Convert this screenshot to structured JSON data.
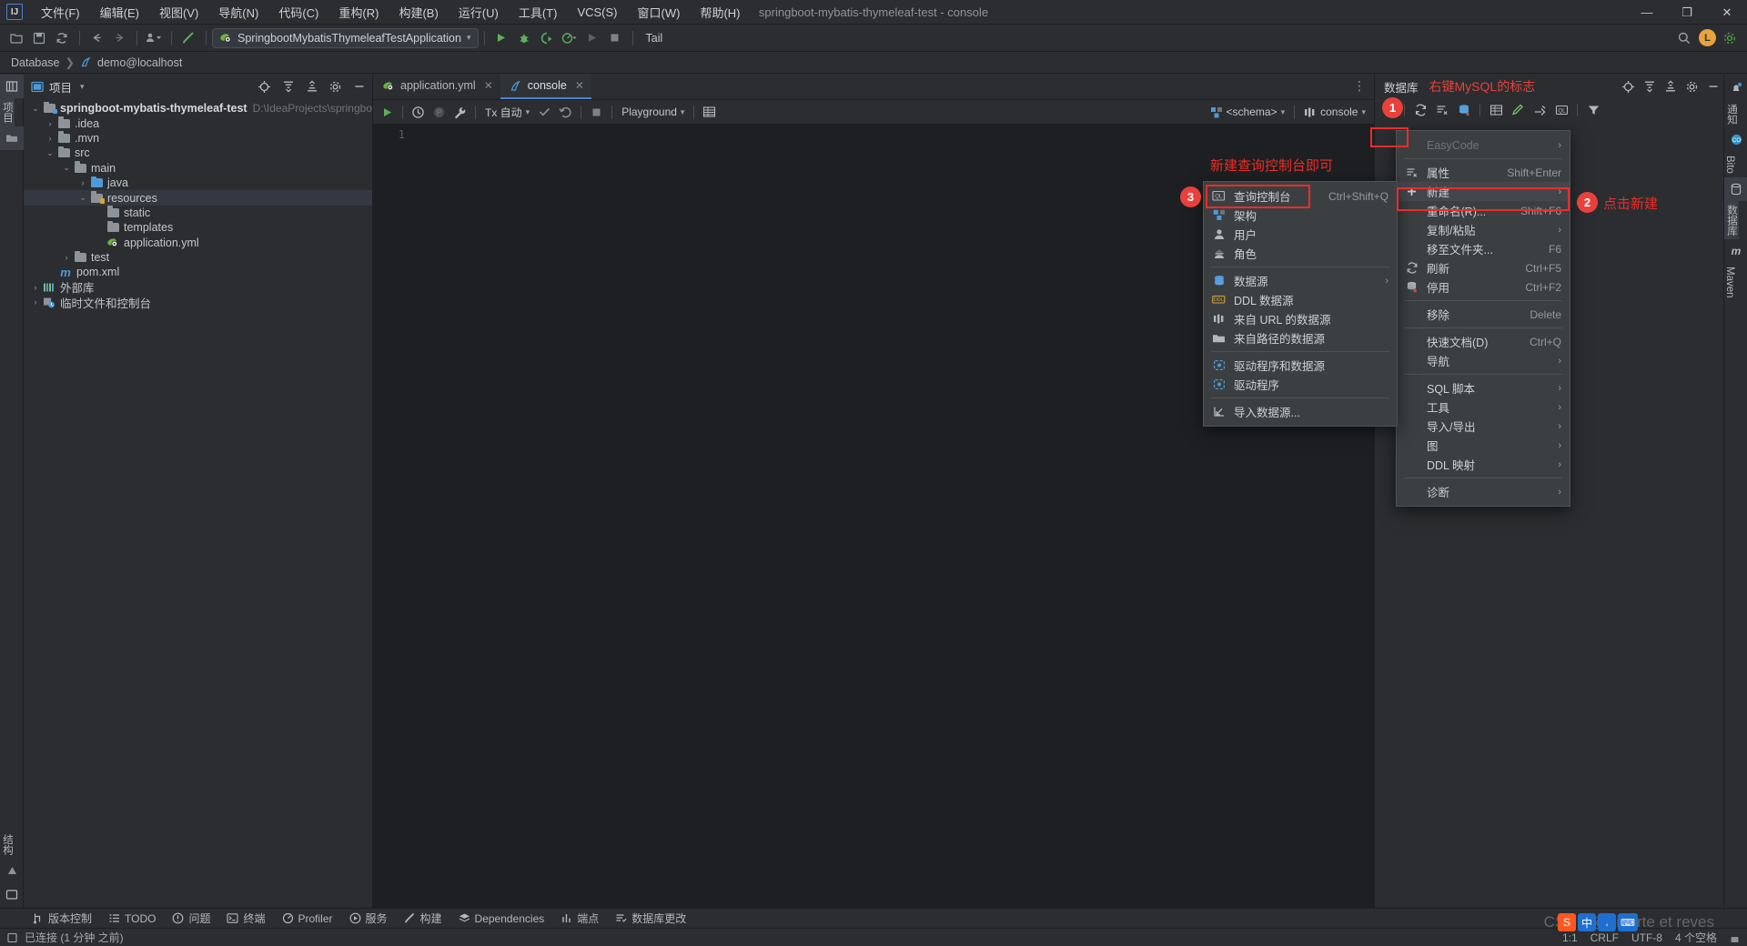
{
  "window": {
    "title": "springboot-mybatis-thymeleaf-test - console",
    "logo": "IJ",
    "controls": {
      "minimize": "—",
      "maximize": "❐",
      "close": "✕"
    }
  },
  "menubar": [
    {
      "label": "文件(F)"
    },
    {
      "label": "编辑(E)"
    },
    {
      "label": "视图(V)"
    },
    {
      "label": "导航(N)"
    },
    {
      "label": "代码(C)"
    },
    {
      "label": "重构(R)"
    },
    {
      "label": "构建(B)"
    },
    {
      "label": "运行(U)"
    },
    {
      "label": "工具(T)"
    },
    {
      "label": "VCS(S)"
    },
    {
      "label": "窗口(W)"
    },
    {
      "label": "帮助(H)"
    }
  ],
  "toolbar": {
    "icons": [
      "open-folder-icon",
      "save-icon",
      "sync-icon",
      "back-arrow-icon",
      "forward-arrow-icon",
      "profile-dropdown-icon",
      "build-hammer-icon"
    ],
    "run_config": "SpringbootMybatisThymeleafTestApplication",
    "run_label": "run-icon",
    "debug_label": "debug-icon",
    "coverage_label": "coverage-icon",
    "profile_label": "profile-icon",
    "stop_label": "stop-icon",
    "tail_chip": "Tail",
    "right_icons": [
      "search-icon",
      "avatar",
      "settings-icon"
    ],
    "avatar_initial": "L"
  },
  "breadcrumb": {
    "root": "Database",
    "sep": "❯",
    "current": "demo@localhost"
  },
  "project_panel": {
    "title": "项目",
    "header_icons": [
      "locate-icon",
      "expand-all-icon",
      "collapse-all-icon",
      "gear-icon",
      "hide-icon"
    ],
    "tree": [
      {
        "depth": 0,
        "chev": "⌄",
        "icon": "module-folder",
        "label": "springboot-mybatis-thymeleaf-test",
        "bold": true,
        "path": "D:\\IdeaProjects\\springboot-mybatis-",
        "selected": false
      },
      {
        "depth": 1,
        "chev": "›",
        "icon": "folder",
        "label": ".idea",
        "bold": false,
        "path": "",
        "selected": false
      },
      {
        "depth": 1,
        "chev": "›",
        "icon": "folder",
        "label": ".mvn",
        "bold": false,
        "path": "",
        "selected": false
      },
      {
        "depth": 1,
        "chev": "⌄",
        "icon": "folder",
        "label": "src",
        "bold": false,
        "path": "",
        "selected": false
      },
      {
        "depth": 2,
        "chev": "⌄",
        "icon": "folder",
        "label": "main",
        "bold": false,
        "path": "",
        "selected": false
      },
      {
        "depth": 3,
        "chev": "›",
        "icon": "folder-blue",
        "label": "java",
        "bold": false,
        "path": "",
        "selected": false
      },
      {
        "depth": 3,
        "chev": "⌄",
        "icon": "folder-res",
        "label": "resources",
        "bold": false,
        "path": "",
        "selected": true
      },
      {
        "depth": 4,
        "chev": "",
        "icon": "folder",
        "label": "static",
        "bold": false,
        "path": "",
        "selected": false
      },
      {
        "depth": 4,
        "chev": "",
        "icon": "folder",
        "label": "templates",
        "bold": false,
        "path": "",
        "selected": false
      },
      {
        "depth": 4,
        "chev": "",
        "icon": "spring-yml",
        "label": "application.yml",
        "bold": false,
        "path": "",
        "selected": false
      },
      {
        "depth": 2,
        "chev": "›",
        "icon": "folder",
        "label": "test",
        "bold": false,
        "path": "",
        "selected": false
      },
      {
        "depth": 1,
        "chev": "",
        "icon": "maven-m",
        "label": "pom.xml",
        "bold": false,
        "path": "",
        "selected": false
      },
      {
        "depth": 0,
        "chev": "›",
        "icon": "library",
        "label": "外部库",
        "bold": false,
        "path": "",
        "selected": false
      },
      {
        "depth": 0,
        "chev": "›",
        "icon": "scratch",
        "label": "临时文件和控制台",
        "bold": false,
        "path": "",
        "selected": false
      }
    ]
  },
  "editor": {
    "tabs": [
      {
        "label": "application.yml",
        "icon": "spring-yml-icon",
        "active": false,
        "close": "✕"
      },
      {
        "label": "console",
        "icon": "console-icon",
        "active": true,
        "close": "✕"
      }
    ],
    "tab_overflow": "⋮",
    "toolbar": {
      "execute": "run-icon",
      "history": "history-icon",
      "profile": "p-icon",
      "wrench": "wrench-icon",
      "tx_label": "Tx 自动",
      "commit": "commit-check-icon",
      "rollback": "rollback-icon",
      "stop": "stop-icon",
      "schema_sel": "Playground",
      "grid": "grid-icon",
      "schema_chip": "<schema>",
      "console_chip": "console",
      "plus": "+",
      "refresh": "refresh-icon",
      "properties": "properties-icon"
    },
    "gutter_lines": [
      "1"
    ],
    "code": ""
  },
  "db_panel": {
    "title": "数据库",
    "annotation": "右键MySQL的标志",
    "header_icons": [
      "locate-icon",
      "expand-all-icon",
      "collapse-all-icon",
      "gear-icon",
      "hide-icon"
    ],
    "toolbar_icons": [
      "add-icon",
      "refresh-icon",
      "properties-icon",
      "datasource-icon",
      "table-icon",
      "edit-icon",
      "jump-icon",
      "query-console-icon",
      "filter-icon"
    ]
  },
  "new_submenu": {
    "items": [
      {
        "label": "查询控制台",
        "key": "Ctrl+Shift+Q",
        "icon": "ql-icon",
        "arrow": "",
        "sep_after": false,
        "highlight": true
      },
      {
        "label": "架构",
        "key": "",
        "icon": "schema-icon",
        "arrow": "",
        "sep_after": false,
        "highlight": false
      },
      {
        "label": "用户",
        "key": "",
        "icon": "user-icon",
        "arrow": "",
        "sep_after": false,
        "highlight": false
      },
      {
        "label": "角色",
        "key": "",
        "icon": "role-icon",
        "arrow": "",
        "sep_after": true,
        "highlight": false
      },
      {
        "label": "数据源",
        "key": "",
        "icon": "datasource-icon",
        "arrow": "›",
        "sep_after": false,
        "highlight": false
      },
      {
        "label": "DDL 数据源",
        "key": "",
        "icon": "ddl-icon",
        "arrow": "",
        "sep_after": false,
        "highlight": false
      },
      {
        "label": "来自 URL 的数据源",
        "key": "",
        "icon": "url-icon",
        "arrow": "",
        "sep_after": false,
        "highlight": false
      },
      {
        "label": "来自路径的数据源",
        "key": "",
        "icon": "path-icon",
        "arrow": "",
        "sep_after": true,
        "highlight": false
      },
      {
        "label": "驱动程序和数据源",
        "key": "",
        "icon": "driver-ds-icon",
        "arrow": "",
        "sep_after": false,
        "highlight": false
      },
      {
        "label": "驱动程序",
        "key": "",
        "icon": "driver-icon",
        "arrow": "",
        "sep_after": true,
        "highlight": false
      },
      {
        "label": "导入数据源...",
        "key": "",
        "icon": "import-icon",
        "arrow": "",
        "sep_after": false,
        "highlight": false
      }
    ]
  },
  "context_menu": {
    "items": [
      {
        "label": "EasyCode",
        "key": "",
        "icon": "",
        "arrow": "›",
        "sep_after": true,
        "disabled": true,
        "highlight": false
      },
      {
        "label": "属性",
        "key": "Shift+Enter",
        "icon": "properties-icon",
        "arrow": "",
        "sep_after": false,
        "disabled": false,
        "highlight": false
      },
      {
        "label": "新建",
        "key": "",
        "icon": "plus-icon",
        "arrow": "›",
        "sep_after": false,
        "disabled": false,
        "highlight": true
      },
      {
        "label": "重命名(R)...",
        "key": "Shift+F6",
        "icon": "",
        "arrow": "",
        "sep_after": false,
        "disabled": false,
        "highlight": false
      },
      {
        "label": "复制/粘贴",
        "key": "",
        "icon": "",
        "arrow": "›",
        "sep_after": false,
        "disabled": false,
        "highlight": false
      },
      {
        "label": "移至文件夹...",
        "key": "F6",
        "icon": "",
        "arrow": "",
        "sep_after": false,
        "disabled": false,
        "highlight": false
      },
      {
        "label": "刷新",
        "key": "Ctrl+F5",
        "icon": "refresh-icon",
        "arrow": "",
        "sep_after": false,
        "disabled": false,
        "highlight": false
      },
      {
        "label": "停用",
        "key": "Ctrl+F2",
        "icon": "disable-icon",
        "arrow": "",
        "sep_after": true,
        "disabled": false,
        "highlight": false
      },
      {
        "label": "移除",
        "key": "Delete",
        "icon": "",
        "arrow": "",
        "sep_after": true,
        "disabled": false,
        "highlight": false
      },
      {
        "label": "快速文档(D)",
        "key": "Ctrl+Q",
        "icon": "",
        "arrow": "",
        "sep_after": false,
        "disabled": false,
        "highlight": false
      },
      {
        "label": "导航",
        "key": "",
        "icon": "",
        "arrow": "›",
        "sep_after": true,
        "disabled": false,
        "highlight": false
      },
      {
        "label": "SQL 脚本",
        "key": "",
        "icon": "",
        "arrow": "›",
        "sep_after": false,
        "disabled": false,
        "highlight": false
      },
      {
        "label": "工具",
        "key": "",
        "icon": "",
        "arrow": "›",
        "sep_after": false,
        "disabled": false,
        "highlight": false
      },
      {
        "label": "导入/导出",
        "key": "",
        "icon": "",
        "arrow": "›",
        "sep_after": false,
        "disabled": false,
        "highlight": false
      },
      {
        "label": "图",
        "key": "",
        "icon": "",
        "arrow": "›",
        "sep_after": false,
        "disabled": false,
        "highlight": false
      },
      {
        "label": "DDL 映射",
        "key": "",
        "icon": "",
        "arrow": "›",
        "sep_after": true,
        "disabled": false,
        "highlight": false
      },
      {
        "label": "诊断",
        "key": "",
        "icon": "",
        "arrow": "›",
        "sep_after": false,
        "disabled": false,
        "highlight": false
      }
    ]
  },
  "annotations": {
    "badge1": "1",
    "badge2": "2",
    "badge3": "3",
    "text_new_console": "新建查询控制台即可",
    "text_click_new": "点击新建",
    "text_right_click_mysql": "右键MySQL的标志",
    "accent_red": "#ef2b28"
  },
  "left_rail": {
    "items": [
      {
        "label": "项目",
        "icon": "project-icon"
      },
      {
        "label": "",
        "icon": "folder-icon"
      }
    ],
    "bottom": [
      {
        "label": "结构",
        "icon": "structure-icon"
      },
      {
        "label": "",
        "icon": "terminal-icon"
      }
    ]
  },
  "right_rail": {
    "items": [
      {
        "label": "通知",
        "icon": "bell-icon"
      },
      {
        "label": "Bito",
        "icon": "bito-icon"
      },
      {
        "label": "数据库",
        "icon": "database-icon"
      },
      {
        "label": "Maven",
        "icon": "maven-icon"
      }
    ]
  },
  "toolwindow_bar": [
    {
      "label": "版本控制",
      "icon": "vcs-icon"
    },
    {
      "label": "TODO",
      "icon": "todo-icon"
    },
    {
      "label": "问题",
      "icon": "problems-icon"
    },
    {
      "label": "终端",
      "icon": "terminal-icon"
    },
    {
      "label": "Profiler",
      "icon": "profiler-icon"
    },
    {
      "label": "服务",
      "icon": "services-icon"
    },
    {
      "label": "构建",
      "icon": "build-icon"
    },
    {
      "label": "Dependencies",
      "icon": "dependencies-icon"
    },
    {
      "label": "端点",
      "icon": "endpoints-icon"
    },
    {
      "label": "数据库更改",
      "icon": "db-changes-icon"
    }
  ],
  "statusbar": {
    "left_icon": "console-status-icon",
    "left_text": "已连接 (1 分钟 之前)",
    "right": [
      "1:1",
      "CRLF",
      "UTF-8",
      "4 个空格"
    ],
    "watermark": "CSDN @Liberte et reves"
  }
}
